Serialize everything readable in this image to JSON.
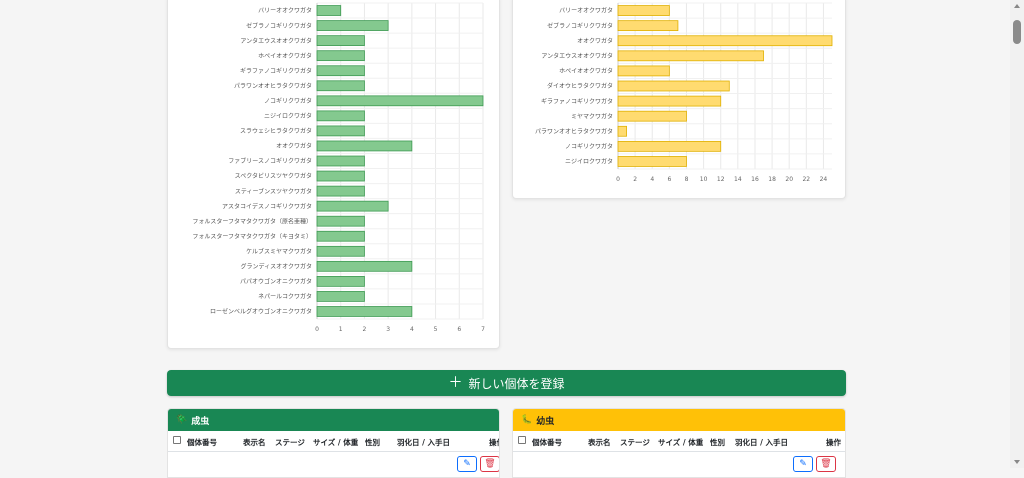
{
  "charts": {
    "chart_data": [
      {
        "type": "bar",
        "orientation": "horizontal",
        "categories": [
          "バリーオオクワガタ",
          "ゼブラノコギリクワガタ",
          "アンタエウスオオクワガタ",
          "ホペイオオクワガタ",
          "ギラファノコギリクワガタ",
          "パラワンオオヒラタクワガタ",
          "ノコギリクワガタ",
          "ニジイロクワガタ",
          "スラウェシヒラタクワガタ",
          "オオクワガタ",
          "ファブリースノコギリクワガタ",
          "スペクタビリスツヤクワガタ",
          "スティーブンスツヤクワガタ",
          "アスタコイデスノコギリクワガタ",
          "フォルスターフタマタクワガタ（原名亜種）",
          "フォルスターフタマタクワガタ（キヨタミ）",
          "ケルブスミヤマクワガタ",
          "グランディスオオクワガタ",
          "パパオウゴンオニクワガタ",
          "ネパールコクワガタ",
          "ローゼンベルグオウゴンオニクワガタ"
        ],
        "values": [
          1,
          3,
          2,
          2,
          2,
          2,
          7,
          2,
          2,
          4,
          2,
          2,
          2,
          3,
          2,
          2,
          2,
          4,
          2,
          2,
          4
        ],
        "xlim": [
          0,
          7
        ],
        "xticks": [
          "0",
          "1",
          "2",
          "3",
          "4",
          "5",
          "6",
          "7"
        ],
        "grid": true,
        "color": "#84c98f",
        "edge_color": "#3d9a52"
      },
      {
        "type": "bar",
        "orientation": "horizontal",
        "categories": [
          "バリーオオクワガタ",
          "ゼブラノコギリクワガタ",
          "オオクワガタ",
          "アンタエウスオオクワガタ",
          "ホペイオオクワガタ",
          "ダイオウヒラタクワガタ",
          "ギラファノコギリクワガタ",
          "ミヤマクワガタ",
          "パラワンオオヒラタクワガタ",
          "ノコギリクワガタ",
          "ニジイロクワガタ"
        ],
        "values": [
          6,
          7,
          25,
          17,
          6,
          13,
          12,
          8,
          1,
          12,
          8
        ],
        "xlim": [
          0,
          25
        ],
        "xticks": [
          "0",
          "2",
          "4",
          "6",
          "8",
          "10",
          "12",
          "14",
          "16",
          "18",
          "20",
          "22",
          "24"
        ],
        "grid": true,
        "color": "#ffdb70",
        "edge_color": "#e0b000"
      }
    ]
  },
  "actions": {
    "register_label": "新しい個体を登録"
  },
  "adult_panel": {
    "title": "成虫",
    "columns": [
      "個体番号",
      "表示名",
      "ステージ",
      "サイズ / 体重",
      "性別",
      "羽化日 / 入手日",
      "操作"
    ]
  },
  "larva_panel": {
    "title": "幼虫",
    "columns": [
      "個体番号",
      "表示名",
      "ステージ",
      "サイズ / 体重",
      "性別",
      "羽化日 / 入手日",
      "操作"
    ]
  },
  "icons": {
    "adult": "beetle-icon",
    "larva": "larva-icon",
    "add": "plus-icon",
    "edit": "pencil-icon",
    "delete": "trash-icon"
  }
}
